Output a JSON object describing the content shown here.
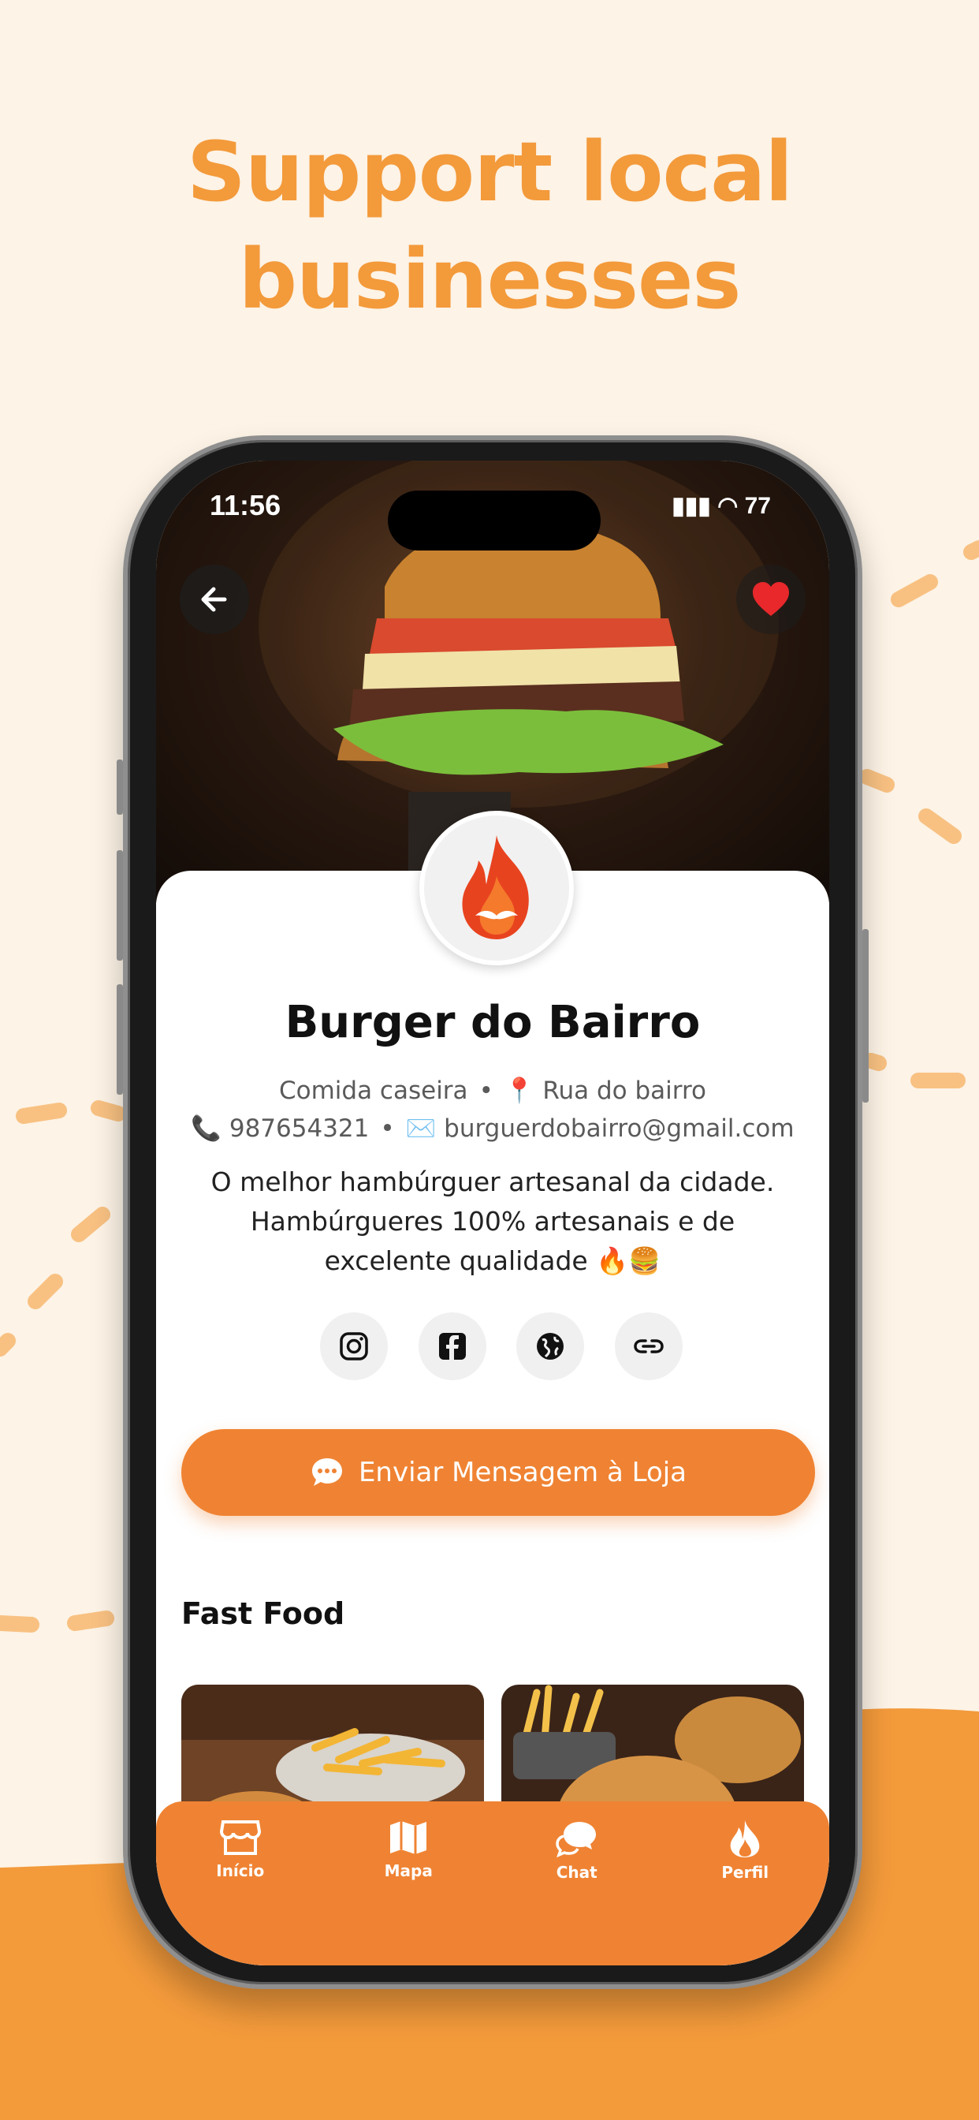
{
  "headline": {
    "line1": "Support local",
    "line2": "businesses"
  },
  "status_bar": {
    "time": "11:56",
    "battery": "77"
  },
  "store": {
    "name": "Burger do Bairro",
    "category": "Comida caseira",
    "address": "Rua do bairro",
    "phone": "987654321",
    "email": "burguerdobairro@gmail.com",
    "description": "O melhor hambúrguer artesanal da cidade. Hambúrgueres  100% artesanais e de excelente qualidade 🔥🍔"
  },
  "socials": [
    "instagram-icon",
    "facebook-icon",
    "globe-icon",
    "link-icon"
  ],
  "message_button": {
    "label": "Enviar Mensagem à Loja"
  },
  "section": {
    "title": "Fast Food"
  },
  "tabs": [
    {
      "label": "Início",
      "icon": "store-icon"
    },
    {
      "label": "Mapa",
      "icon": "map-icon"
    },
    {
      "label": "Chat",
      "icon": "chat-icon"
    },
    {
      "label": "Perfil",
      "icon": "flame-icon"
    }
  ],
  "colors": {
    "accent": "#ef8333",
    "headline": "#f39a3b",
    "background": "#fdf3e6",
    "favorite": "#e8282b"
  }
}
